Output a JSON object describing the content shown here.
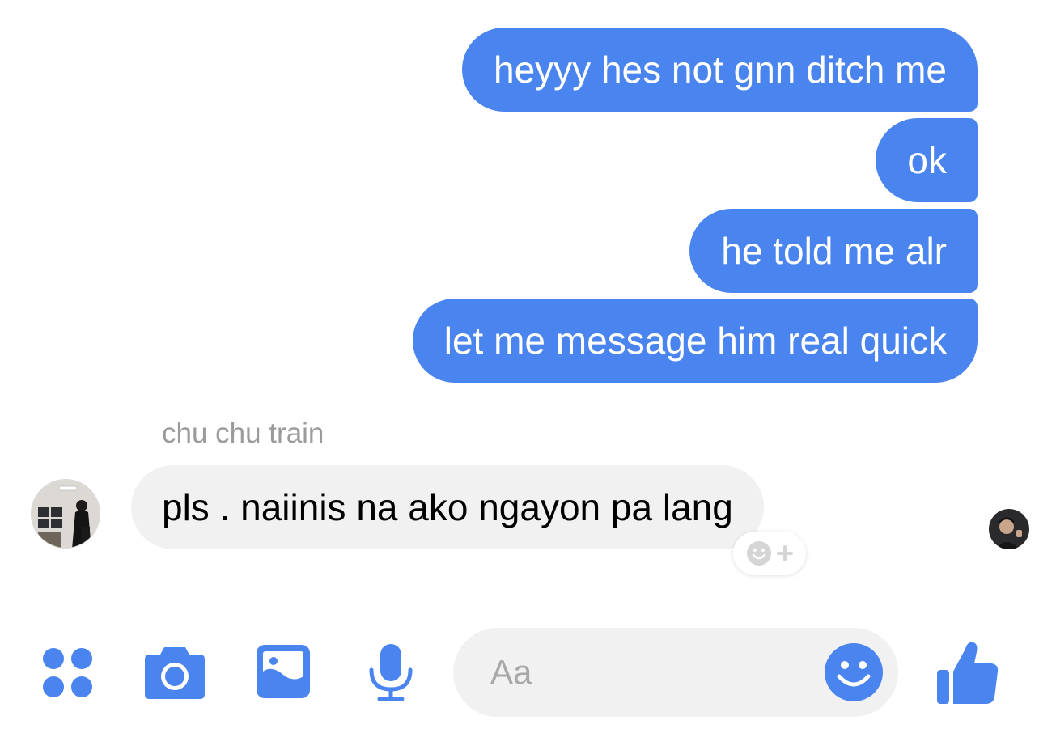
{
  "colors": {
    "accent": "#4a84ee",
    "incoming_bubble": "#f1f1f1",
    "sender_name": "#9b9b9b",
    "placeholder": "#a8a8a8"
  },
  "messages_out": [
    {
      "text": "heyyy hes not gnn ditch me"
    },
    {
      "text": "ok"
    },
    {
      "text": "he told me alr"
    },
    {
      "text": "let me message him real quick"
    }
  ],
  "incoming": {
    "sender": "chu chu train",
    "text": "pls . naiinis na ako ngayon pa lang"
  },
  "composer": {
    "placeholder": "Aa",
    "icons": [
      "apps-icon",
      "camera-icon",
      "gallery-icon",
      "microphone-icon",
      "emoji-icon",
      "thumbs-up-icon"
    ]
  }
}
